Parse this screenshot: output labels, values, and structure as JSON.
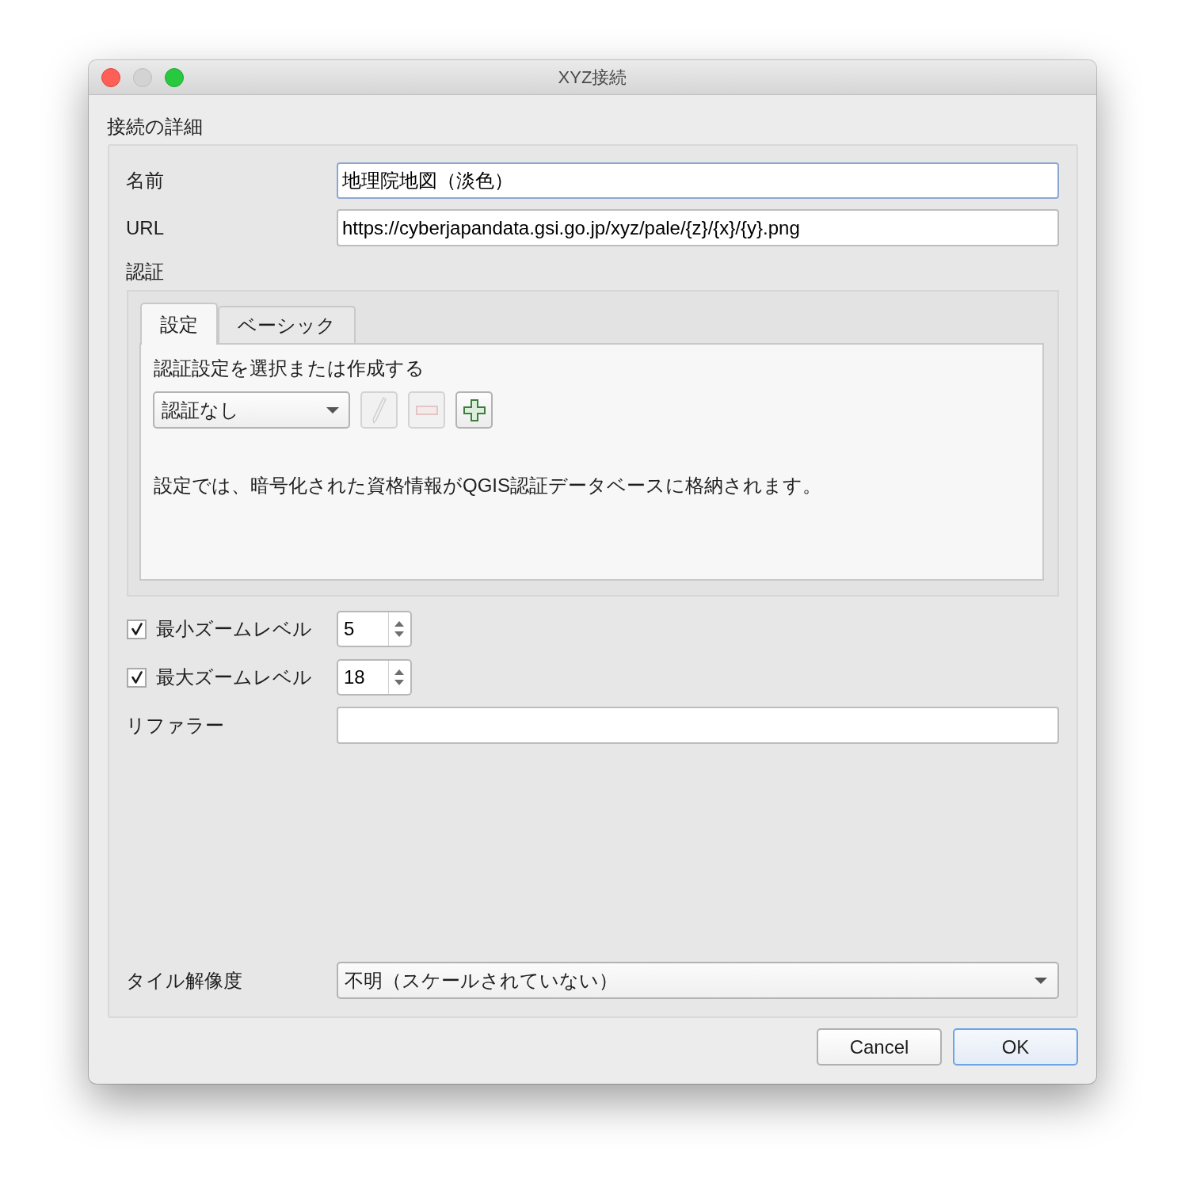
{
  "window": {
    "title": "XYZ接続"
  },
  "connection_details": {
    "title": "接続の詳細",
    "name": {
      "label": "名前",
      "value": "地理院地図（淡色）",
      "focused": true
    },
    "url": {
      "label": "URL",
      "value": "https://cyberjapandata.gsi.go.jp/xyz/pale/{z}/{x}/{y}.png",
      "focused": false
    },
    "authentication": {
      "label": "認証",
      "tabs": [
        {
          "label": "設定",
          "selected": true
        },
        {
          "label": "ベーシック",
          "selected": false
        }
      ],
      "prompt": "認証設定を選択または作成する",
      "config_select": {
        "value": "認証なし"
      },
      "buttons": [
        {
          "kind": "edit",
          "disabled": true
        },
        {
          "kind": "remove",
          "disabled": true
        },
        {
          "kind": "add",
          "disabled": false
        }
      ],
      "note": "設定では、暗号化された資格情報がQGIS認証データベースに格納されます。"
    },
    "zoom_levels": [
      {
        "label": "最小ズームレベル",
        "checked": true,
        "value": "5"
      },
      {
        "label": "最大ズームレベル",
        "checked": true,
        "value": "18"
      }
    ],
    "referer": {
      "label": "リファラー"
    },
    "tile_resolution": {
      "label": "タイル解像度",
      "value": "不明（スケールされていない）"
    }
  },
  "buttons": [
    {
      "label": "Cancel",
      "default": false
    },
    {
      "label": "OK",
      "default": true
    }
  ]
}
